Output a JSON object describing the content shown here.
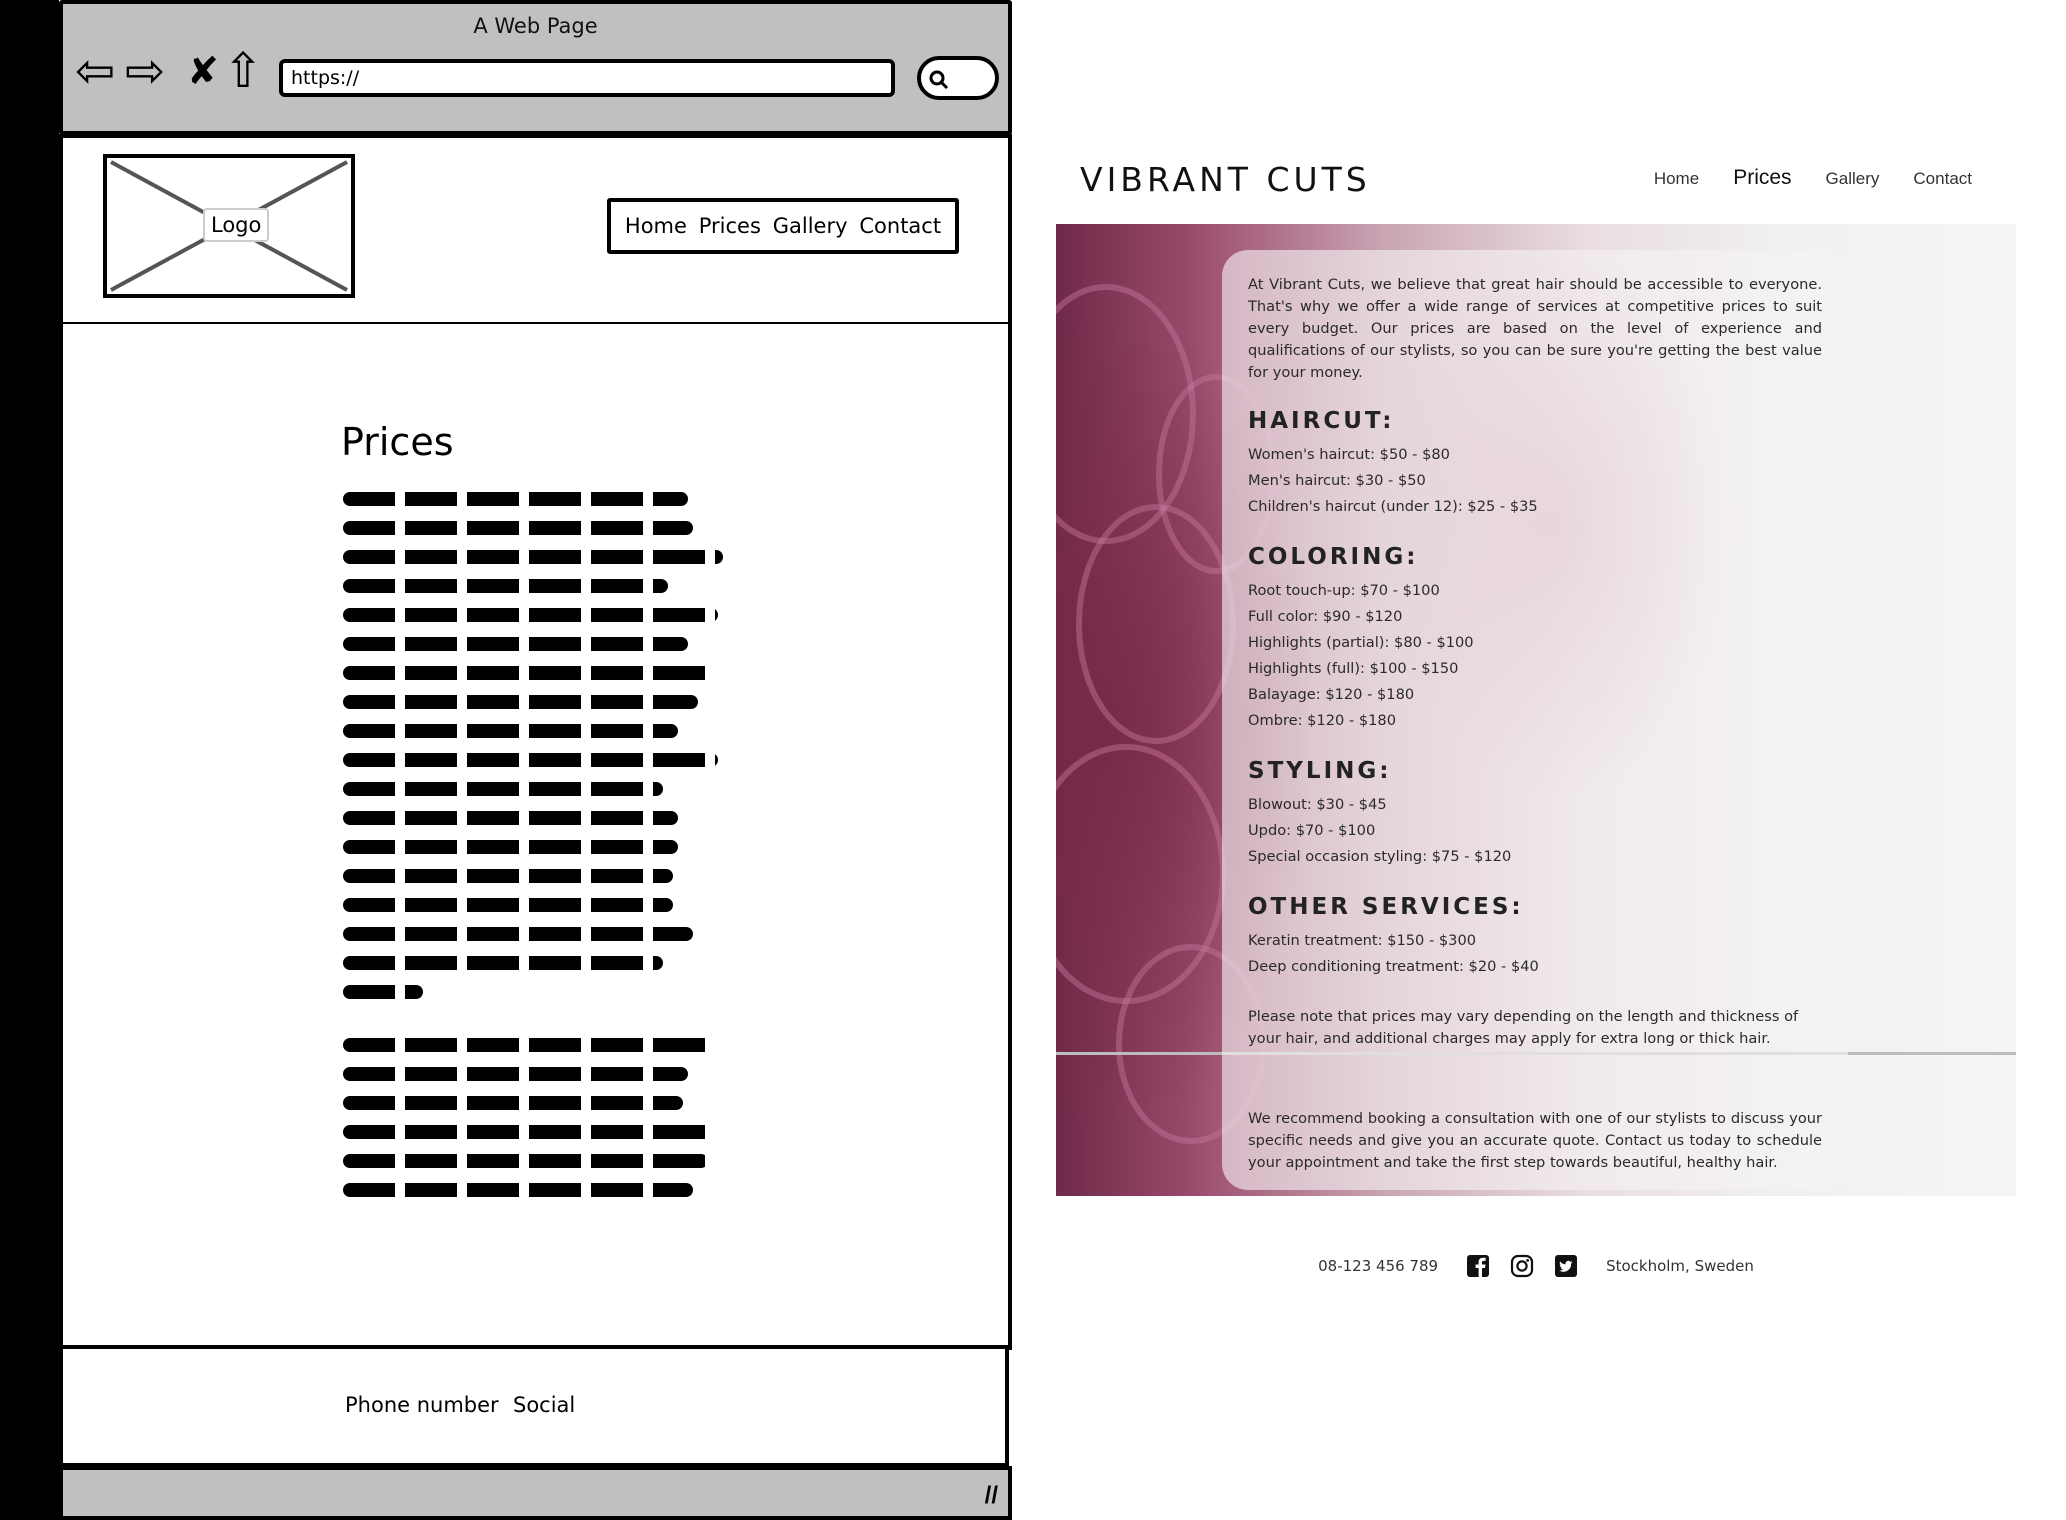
{
  "wireframe": {
    "window_title": "A Web Page",
    "url": "https://",
    "logo_label": "Logo",
    "nav": [
      "Home",
      "Prices",
      "Gallery",
      "Contact"
    ],
    "heading": "Prices",
    "footer": {
      "phone": "Phone number",
      "social": "Social"
    }
  },
  "site": {
    "brand": "VIBRANT CUTS",
    "nav": [
      {
        "label": "Home",
        "active": false
      },
      {
        "label": "Prices",
        "active": true
      },
      {
        "label": "Gallery",
        "active": false
      },
      {
        "label": "Contact",
        "active": false
      }
    ],
    "intro": "At Vibrant Cuts, we believe that great hair should be accessible to everyone. That's why we offer a wide range of services at competitive prices to suit every budget. Our prices are based on the level of experience and qualifications of our stylists, so you can be sure you're getting the best value for your money.",
    "sections": [
      {
        "title": "HAIRCUT:",
        "items": [
          "Women's haircut: $50 - $80",
          "Men's haircut: $30 - $50",
          "Children's haircut (under 12): $25 - $35"
        ]
      },
      {
        "title": "COLORING:",
        "items": [
          "Root touch-up: $70 - $100",
          "Full color: $90 - $120",
          "Highlights (partial): $80 - $100",
          "Highlights (full): $100 - $150",
          "Balayage: $120 - $180",
          "Ombre: $120 - $180"
        ]
      },
      {
        "title": "STYLING:",
        "items": [
          "Blowout: $30 - $45",
          "Updo: $70 - $100",
          "Special occasion styling: $75 - $120"
        ]
      },
      {
        "title": "OTHER SERVICES:",
        "items": [
          "Keratin treatment: $150 - $300",
          "Deep conditioning treatment: $20 - $40"
        ]
      }
    ],
    "note": "Please note that prices may vary depending on the length and thickness of your hair, and additional charges may apply for extra long or thick hair.",
    "recommend": "We recommend booking a consultation with one of our stylists to discuss your specific needs and give you an accurate quote. Contact us today to schedule your appointment and take the first step towards beautiful, healthy hair.",
    "footer": {
      "phone": "08-123 456 789",
      "location": "Stockholm, Sweden",
      "social_icons": [
        "facebook-icon",
        "instagram-icon",
        "twitter-icon"
      ]
    }
  }
}
